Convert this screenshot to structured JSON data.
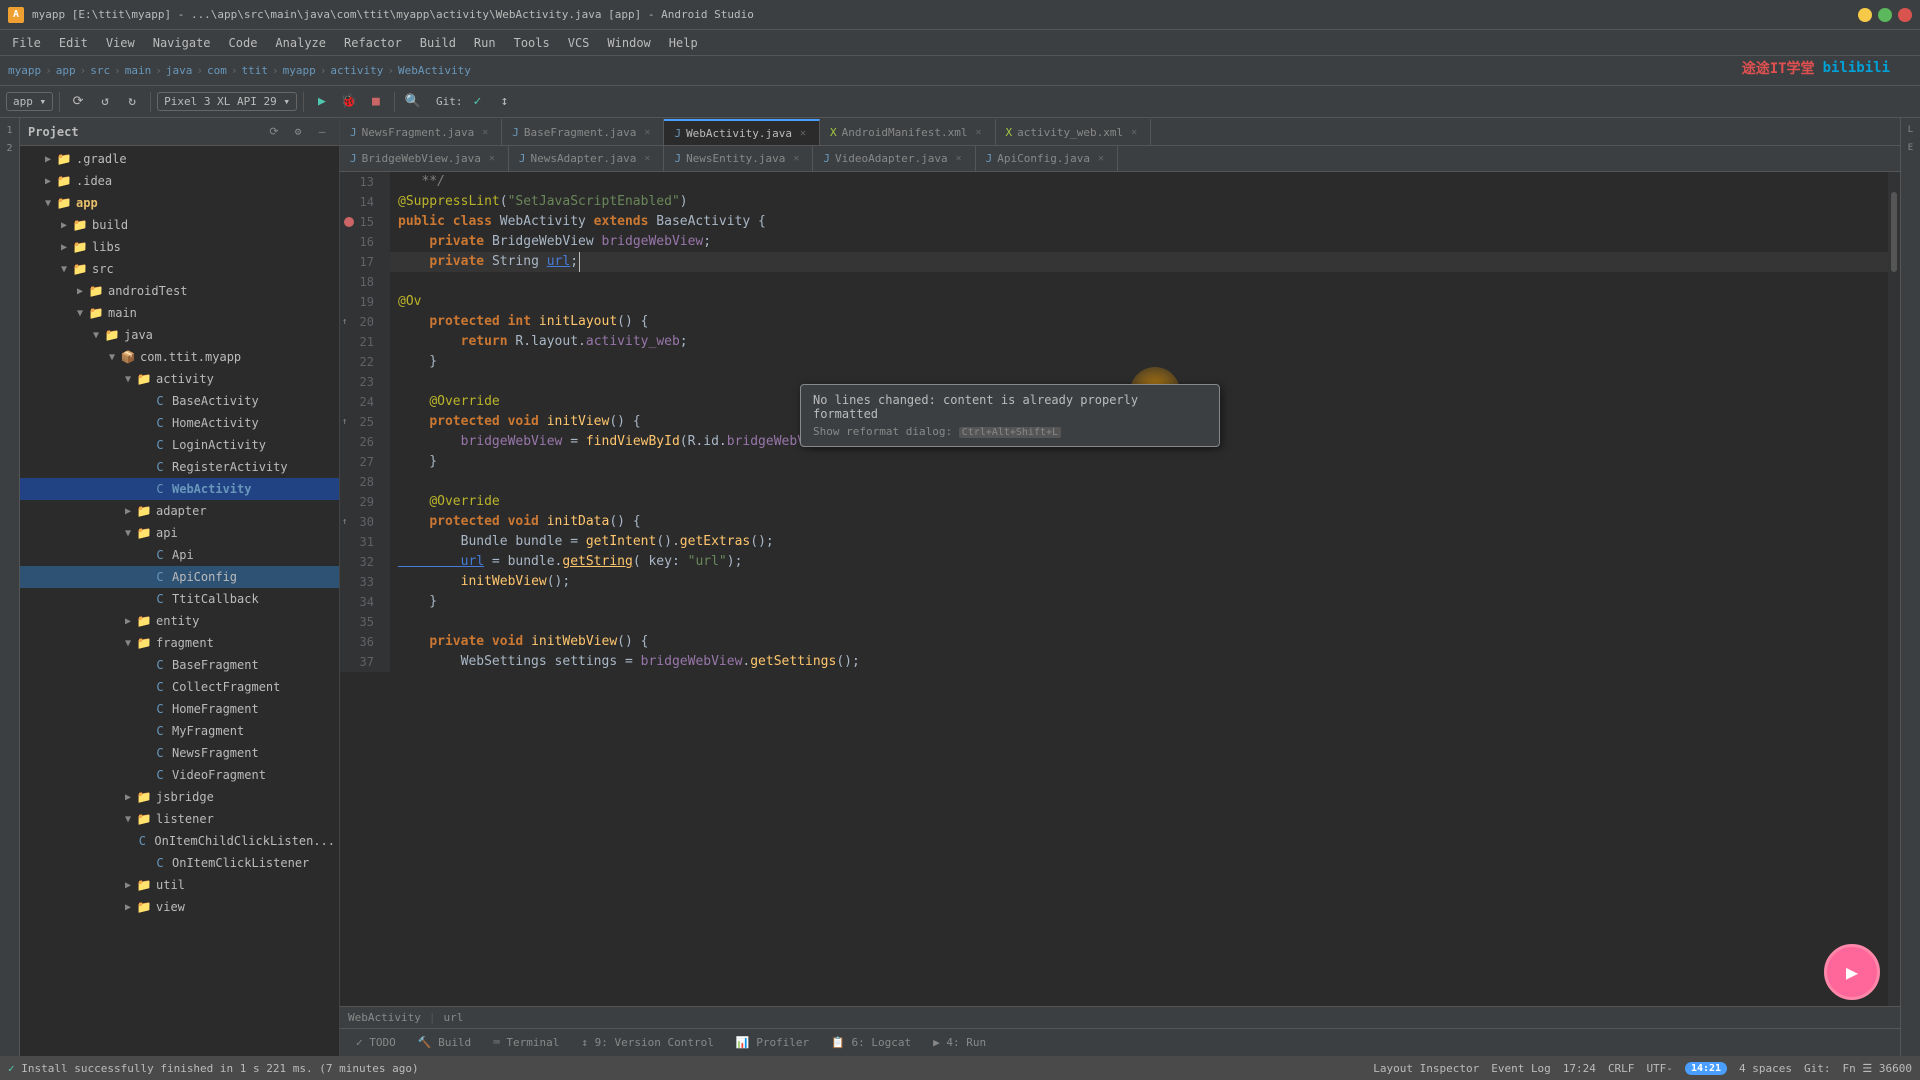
{
  "titleBar": {
    "icon": "A",
    "title": "myapp [E:\\ttit\\myapp] - ...\\app\\src\\main\\java\\com\\ttit\\myapp\\activity\\WebActivity.java [app] - Android Studio"
  },
  "menuBar": {
    "items": [
      "File",
      "Edit",
      "View",
      "Navigate",
      "Code",
      "Analyze",
      "Refactor",
      "Build",
      "Run",
      "Tools",
      "VCS",
      "Window",
      "Help"
    ]
  },
  "navBar": {
    "items": [
      "myapp",
      "app",
      "src",
      "main",
      "java",
      "com",
      "ttit",
      "myapp",
      "activity",
      "WebActivity"
    ]
  },
  "tabsRow1": [
    {
      "label": "NewsFragment.java",
      "active": false,
      "icon": "J"
    },
    {
      "label": "BaseFragment.java",
      "active": false,
      "icon": "J"
    },
    {
      "label": "WebActivity.java",
      "active": true,
      "icon": "J"
    },
    {
      "label": "AndroidManifest.xml",
      "active": false,
      "icon": "X"
    },
    {
      "label": "activity_web.xml",
      "active": false,
      "icon": "X"
    }
  ],
  "tabsRow2": [
    {
      "label": "BridgeWebView.java",
      "active": false,
      "icon": "J"
    },
    {
      "label": "NewsAdapter.java",
      "active": false,
      "icon": "J"
    },
    {
      "label": "NewsEntity.java",
      "active": false,
      "icon": "J"
    },
    {
      "label": "VideoAdapter.java",
      "active": false,
      "icon": "J"
    },
    {
      "label": "ApiConfig.java",
      "active": false,
      "icon": "J"
    }
  ],
  "editorTitle": "WebActivity.java",
  "codeLines": [
    {
      "num": 13,
      "content": "   **/",
      "type": "comment"
    },
    {
      "num": 14,
      "content": "@SuppressLint(\"SetJavaScriptEnabled\")",
      "type": "annotation"
    },
    {
      "num": 15,
      "content": "public class WebActivity extends BaseActivity {",
      "type": "code"
    },
    {
      "num": 16,
      "content": "    private BridgeWebView bridgeWebView;",
      "type": "code"
    },
    {
      "num": 17,
      "content": "    private String url;",
      "type": "code"
    },
    {
      "num": 18,
      "content": "",
      "type": "empty"
    },
    {
      "num": 19,
      "content": "@Ov",
      "type": "code-partial"
    },
    {
      "num": 20,
      "content": "    protected int initLayout() {",
      "type": "code",
      "hasIndicator": true
    },
    {
      "num": 21,
      "content": "        return R.layout.activity_web;",
      "type": "code"
    },
    {
      "num": 22,
      "content": "    }",
      "type": "code"
    },
    {
      "num": 23,
      "content": "",
      "type": "empty"
    },
    {
      "num": 24,
      "content": "    @Override",
      "type": "annotation"
    },
    {
      "num": 25,
      "content": "    protected void initView() {",
      "type": "code",
      "hasIndicator": true
    },
    {
      "num": 26,
      "content": "        bridgeWebView = findViewById(R.id.bridgeWebView);",
      "type": "code"
    },
    {
      "num": 27,
      "content": "    }",
      "type": "code"
    },
    {
      "num": 28,
      "content": "",
      "type": "empty"
    },
    {
      "num": 29,
      "content": "    @Override",
      "type": "annotation"
    },
    {
      "num": 30,
      "content": "    protected void initData() {",
      "type": "code",
      "hasIndicator": true
    },
    {
      "num": 31,
      "content": "        Bundle bundle = getIntent().getExtras();",
      "type": "code"
    },
    {
      "num": 32,
      "content": "        url = bundle.getString( key: \"url\");",
      "type": "code"
    },
    {
      "num": 33,
      "content": "        initWebView();",
      "type": "code"
    },
    {
      "num": 34,
      "content": "    }",
      "type": "code"
    },
    {
      "num": 35,
      "content": "",
      "type": "empty"
    },
    {
      "num": 36,
      "content": "    private void initWebView() {",
      "type": "code"
    },
    {
      "num": 37,
      "content": "        WebSettings settings = bridgeWebView.getSettings();",
      "type": "code"
    }
  ],
  "tooltip": {
    "mainText": "No lines changed: content is already properly formatted",
    "hintText": "Show reformat dialog:",
    "shortcut": "Ctrl+Alt+Shift+L"
  },
  "treeItems": [
    {
      "label": "Project",
      "indent": 0,
      "type": "header",
      "expanded": true
    },
    {
      "label": ".gradle",
      "indent": 1,
      "type": "folder",
      "expanded": false
    },
    {
      "label": ".idea",
      "indent": 1,
      "type": "folder",
      "expanded": false
    },
    {
      "label": "app",
      "indent": 1,
      "type": "folder",
      "expanded": true,
      "bold": true
    },
    {
      "label": "build",
      "indent": 2,
      "type": "folder",
      "expanded": false
    },
    {
      "label": "libs",
      "indent": 2,
      "type": "folder",
      "expanded": false
    },
    {
      "label": "src",
      "indent": 2,
      "type": "folder",
      "expanded": true
    },
    {
      "label": "androidTest",
      "indent": 3,
      "type": "folder",
      "expanded": false
    },
    {
      "label": "main",
      "indent": 3,
      "type": "folder",
      "expanded": true
    },
    {
      "label": "java",
      "indent": 4,
      "type": "folder",
      "expanded": true
    },
    {
      "label": "com.ttit.myapp",
      "indent": 5,
      "type": "folder",
      "expanded": true
    },
    {
      "label": "activity",
      "indent": 6,
      "type": "folder",
      "expanded": true
    },
    {
      "label": "BaseActivity",
      "indent": 7,
      "type": "java",
      "icon": "C"
    },
    {
      "label": "HomeActivity",
      "indent": 7,
      "type": "java",
      "icon": "C"
    },
    {
      "label": "LoginActivity",
      "indent": 7,
      "type": "java",
      "icon": "C"
    },
    {
      "label": "RegisterActivity",
      "indent": 7,
      "type": "java",
      "icon": "C"
    },
    {
      "label": "WebActivity",
      "indent": 7,
      "type": "java-active",
      "icon": "C"
    },
    {
      "label": "adapter",
      "indent": 6,
      "type": "folder",
      "expanded": false
    },
    {
      "label": "api",
      "indent": 6,
      "type": "folder",
      "expanded": true
    },
    {
      "label": "Api",
      "indent": 7,
      "type": "java",
      "icon": "C"
    },
    {
      "label": "ApiConfig",
      "indent": 7,
      "type": "java-selected",
      "icon": "C"
    },
    {
      "label": "TtitCallback",
      "indent": 7,
      "type": "java",
      "icon": "C"
    },
    {
      "label": "entity",
      "indent": 6,
      "type": "folder",
      "expanded": false
    },
    {
      "label": "fragment",
      "indent": 6,
      "type": "folder",
      "expanded": true
    },
    {
      "label": "BaseFragment",
      "indent": 7,
      "type": "java",
      "icon": "C"
    },
    {
      "label": "CollectFragment",
      "indent": 7,
      "type": "java",
      "icon": "C"
    },
    {
      "label": "HomeFragment",
      "indent": 7,
      "type": "java",
      "icon": "C"
    },
    {
      "label": "MyFragment",
      "indent": 7,
      "type": "java",
      "icon": "C"
    },
    {
      "label": "NewsFragment",
      "indent": 7,
      "type": "java",
      "icon": "C"
    },
    {
      "label": "VideoFragment",
      "indent": 7,
      "type": "java",
      "icon": "C"
    },
    {
      "label": "jsbridge",
      "indent": 6,
      "type": "folder",
      "expanded": false
    },
    {
      "label": "listener",
      "indent": 6,
      "type": "folder",
      "expanded": true
    },
    {
      "label": "OnItemChildClickListener",
      "indent": 7,
      "type": "java",
      "icon": "C"
    },
    {
      "label": "OnItemClickListener",
      "indent": 7,
      "type": "java",
      "icon": "C"
    },
    {
      "label": "util",
      "indent": 6,
      "type": "folder",
      "expanded": false
    },
    {
      "label": "view",
      "indent": 6,
      "type": "folder",
      "expanded": false
    }
  ],
  "bottomTabs": [
    {
      "label": "TODO",
      "num": null,
      "icon": "✓"
    },
    {
      "label": "Build",
      "num": null,
      "icon": "🔨"
    },
    {
      "label": "Terminal",
      "num": null,
      "icon": ">"
    },
    {
      "label": "9: Version Control",
      "num": null,
      "icon": "↕"
    },
    {
      "label": "Profiler",
      "num": null,
      "icon": "~"
    },
    {
      "label": "6: Logcat",
      "num": null,
      "icon": "📋"
    },
    {
      "label": "4: Run",
      "num": null,
      "icon": "▶"
    }
  ],
  "statusBar": {
    "message": "Install successfully finished in 1 s 221 ms. (7 minutes ago)",
    "position": "17:24",
    "encoding": "CRLF",
    "charset": "UTF-",
    "badgeNum": "14:21",
    "gitInfo": "Git:",
    "rightInfo": "Fn ☰ 36600",
    "rightPanels": [
      "Layout Inspector",
      "Event Log"
    ]
  },
  "urlBar": {
    "file": "WebActivity",
    "url": "url"
  },
  "watermark": {
    "text1": "途途IT学堂",
    "text2": "bilibili"
  },
  "videoWidget": {
    "icon": "▶"
  }
}
